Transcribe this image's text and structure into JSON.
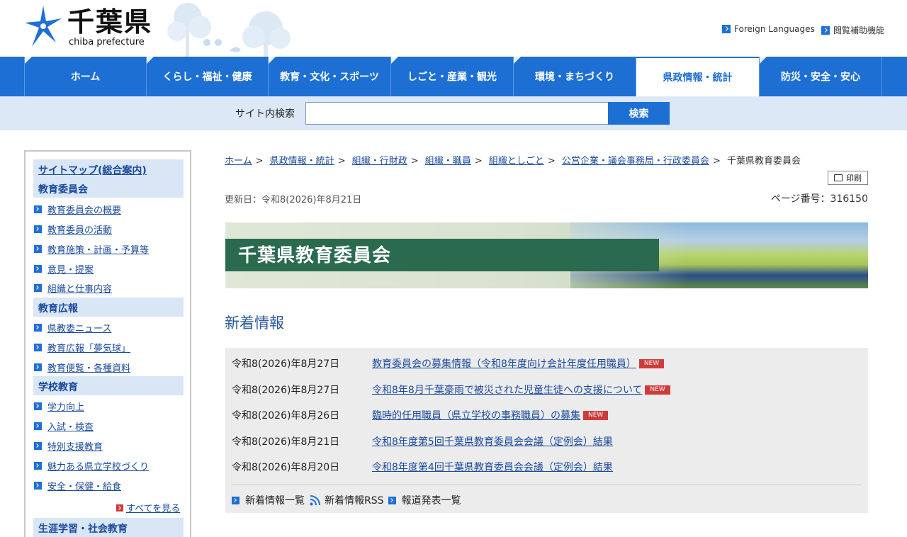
{
  "header": {
    "logo_kanji": "千葉県",
    "logo_roman": "chiba prefecture",
    "links": [
      "Foreign Languages",
      "閲覧補助機能"
    ]
  },
  "nav": {
    "items": [
      "ホーム",
      "くらし・福祉・健康",
      "教育・文化・スポーツ",
      "しごと・産業・観光",
      "環境・まちづくり",
      "県政情報・統計",
      "防災・安全・安心"
    ],
    "active_index": 5
  },
  "search": {
    "label": "サイト内検索",
    "value": "",
    "button": "検索"
  },
  "sidebar": {
    "sitemap": "サイトマップ(総合案内)",
    "sections": [
      {
        "title": "教育委員会",
        "items": [
          "教育委員会の概要",
          "教育委員の活動",
          "教育施策・計画・予算等",
          "意見・提案",
          "組織と仕事内容"
        ]
      },
      {
        "title": "教育広報",
        "items": [
          "県教委ニュース",
          "教育広報「夢気球」",
          "教育便覧・各種資料"
        ]
      },
      {
        "title": "学校教育",
        "items": [
          "学力向上",
          "入試・検査",
          "特別支援教育",
          "魅力ある県立学校づくり",
          "安全・保健・給食"
        ]
      },
      {
        "title": "生涯学習・社会教育",
        "items": []
      }
    ],
    "more": "すべてを見る"
  },
  "breadcrumb": [
    "ホーム",
    "県政情報・統計",
    "組織・行財政",
    "組織・職員",
    "組織としごと",
    "公営企業・議会事務局・行政委員会"
  ],
  "breadcrumb_current": "千葉県教育委員会",
  "print_label": "印刷",
  "updated": "更新日：令和8(2026)年8月21日",
  "page_number": "ページ番号：316150",
  "banner_title": "千葉県教育委員会",
  "news": {
    "heading": "新着情報",
    "items": [
      {
        "date": "令和8(2026)年8月27日",
        "title": "教育委員会の募集情報（令和8年度向け会計年度任用職員）",
        "new": "NEW"
      },
      {
        "date": "令和8(2026)年8月27日",
        "title": "令和8年8月千葉豪雨で被災された児童生徒への支援について",
        "new": "NEW"
      },
      {
        "date": "令和8(2026)年8月26日",
        "title": "臨時的任用職員（県立学校の事務職員）の募集",
        "new": "NEW"
      },
      {
        "date": "令和8(2026)年8月21日",
        "title": "令和8年度第5回千葉県教育委員会会議（定例会）結果",
        "new": ""
      },
      {
        "date": "令和8(2026)年8月20日",
        "title": "令和8年度第4回千葉県教育委員会会議（定例会）結果",
        "new": ""
      }
    ],
    "footer": [
      "新着情報一覧",
      "新着情報RSS",
      "報道発表一覧"
    ]
  },
  "colors": {
    "primary_blue": "#1d6fd3",
    "banner_green": "#2a6a4f",
    "new_red": "#d13a3a"
  }
}
